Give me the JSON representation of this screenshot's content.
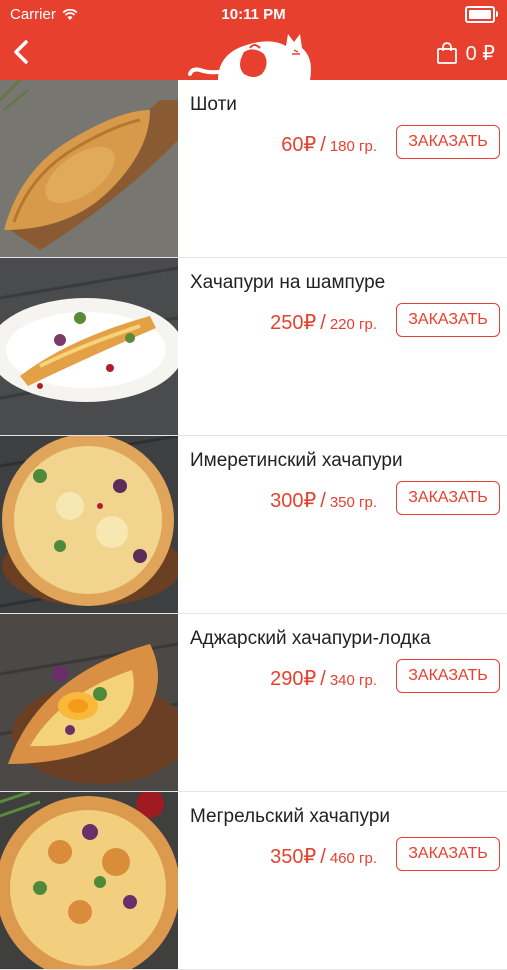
{
  "status_bar": {
    "carrier": "Carrier",
    "time": "10:11 PM"
  },
  "header": {
    "cart_total": "0 ₽",
    "brand_color": "#e8402f"
  },
  "products": [
    {
      "name": "Шоти",
      "price": "60₽",
      "slash": "/",
      "weight": "180 гр.",
      "order_label": "ЗАКАЗАТЬ",
      "photo": "shoti-bread"
    },
    {
      "name": "Хачапури на шампуре",
      "price": "250₽",
      "slash": "/",
      "weight": "220 гр.",
      "order_label": "ЗАКАЗАТЬ",
      "photo": "khachapuri-skewer"
    },
    {
      "name": "Имеретинский хачапури",
      "price": "300₽",
      "slash": "/",
      "weight": "350 гр.",
      "order_label": "ЗАКАЗАТЬ",
      "photo": "imeretian-khachapuri"
    },
    {
      "name": "Аджарский хачапури-лодка",
      "price": "290₽",
      "slash": "/",
      "weight": "340 гр.",
      "order_label": "ЗАКАЗАТЬ",
      "photo": "adjarian-khachapuri"
    },
    {
      "name": "Мегрельский хачапури",
      "price": "350₽",
      "slash": "/",
      "weight": "460 гр.",
      "order_label": "ЗАКАЗАТЬ",
      "photo": "megrelian-khachapuri"
    }
  ]
}
